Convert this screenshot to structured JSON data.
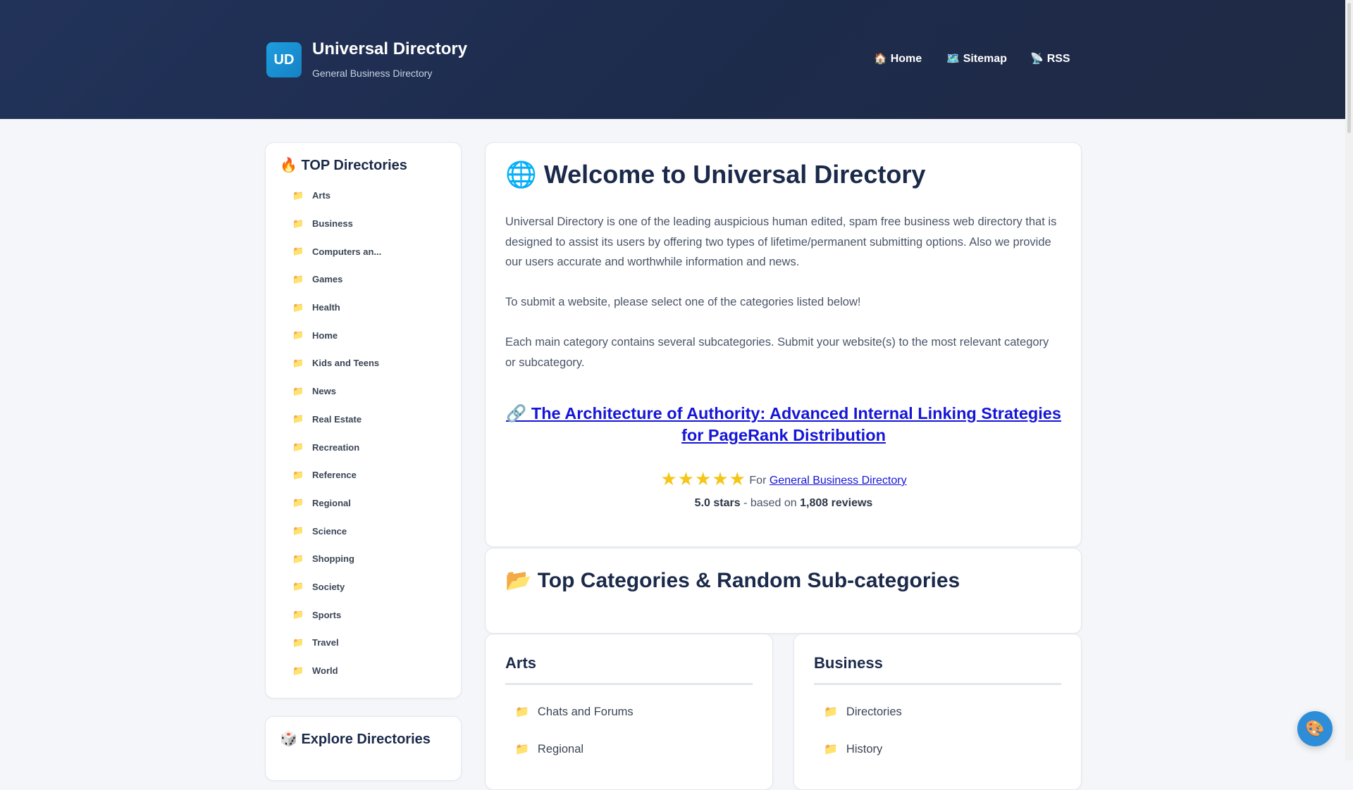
{
  "header": {
    "logo_text": "UD",
    "title": "Universal Directory",
    "subtitle": "General Business Directory",
    "nav": [
      {
        "icon": "🏠",
        "label": "Home"
      },
      {
        "icon": "🗺️",
        "label": "Sitemap"
      },
      {
        "icon": "📡",
        "label": "RSS"
      }
    ]
  },
  "sidebar": {
    "top_title": "🔥 TOP Directories",
    "folder_icon": "📁",
    "items": [
      "Arts",
      "Business",
      "Computers an...",
      "Games",
      "Health",
      "Home",
      "Kids and Teens",
      "News",
      "Real Estate",
      "Recreation",
      "Reference",
      "Regional",
      "Science",
      "Shopping",
      "Society",
      "Sports",
      "Travel",
      "World"
    ],
    "explore_title": "🎲 Explore Directories"
  },
  "welcome": {
    "title": "🌐 Welcome to Universal Directory",
    "p1": "Universal Directory is one of the leading auspicious human edited, spam free business web directory that is designed to assist its users by offering two types of lifetime/permanent submitting options. Also we provide our users accurate and worthwhile information and news.",
    "p2": "To submit a website, please select one of the categories listed below!",
    "p3": "Each main category contains several subcategories. Submit your website(s) to the most relevant category or subcategory.",
    "featured_link": "🔗 The Architecture of Authority: Advanced Internal Linking Strategies for PageRank Distribution",
    "stars": "★★★★★",
    "rating_for": "For",
    "rating_link": "General Business Directory",
    "rating_stars": "5.0 stars",
    "rating_mid": "- based on",
    "rating_count": "1,808 reviews"
  },
  "top_categories": {
    "title": "📂 Top Categories & Random Sub-categories"
  },
  "categories": [
    {
      "name": "Arts",
      "items": [
        "Chats and Forums",
        "Regional"
      ]
    },
    {
      "name": "Business",
      "items": [
        "Directories",
        "History"
      ]
    }
  ],
  "fab": {
    "icon": "🎨"
  },
  "colors": {
    "header_bg": "#1f2e4f",
    "accent": "#1e9ee0",
    "link": "#1515d8",
    "star": "#f5c518",
    "heading": "#1b2a4a"
  }
}
